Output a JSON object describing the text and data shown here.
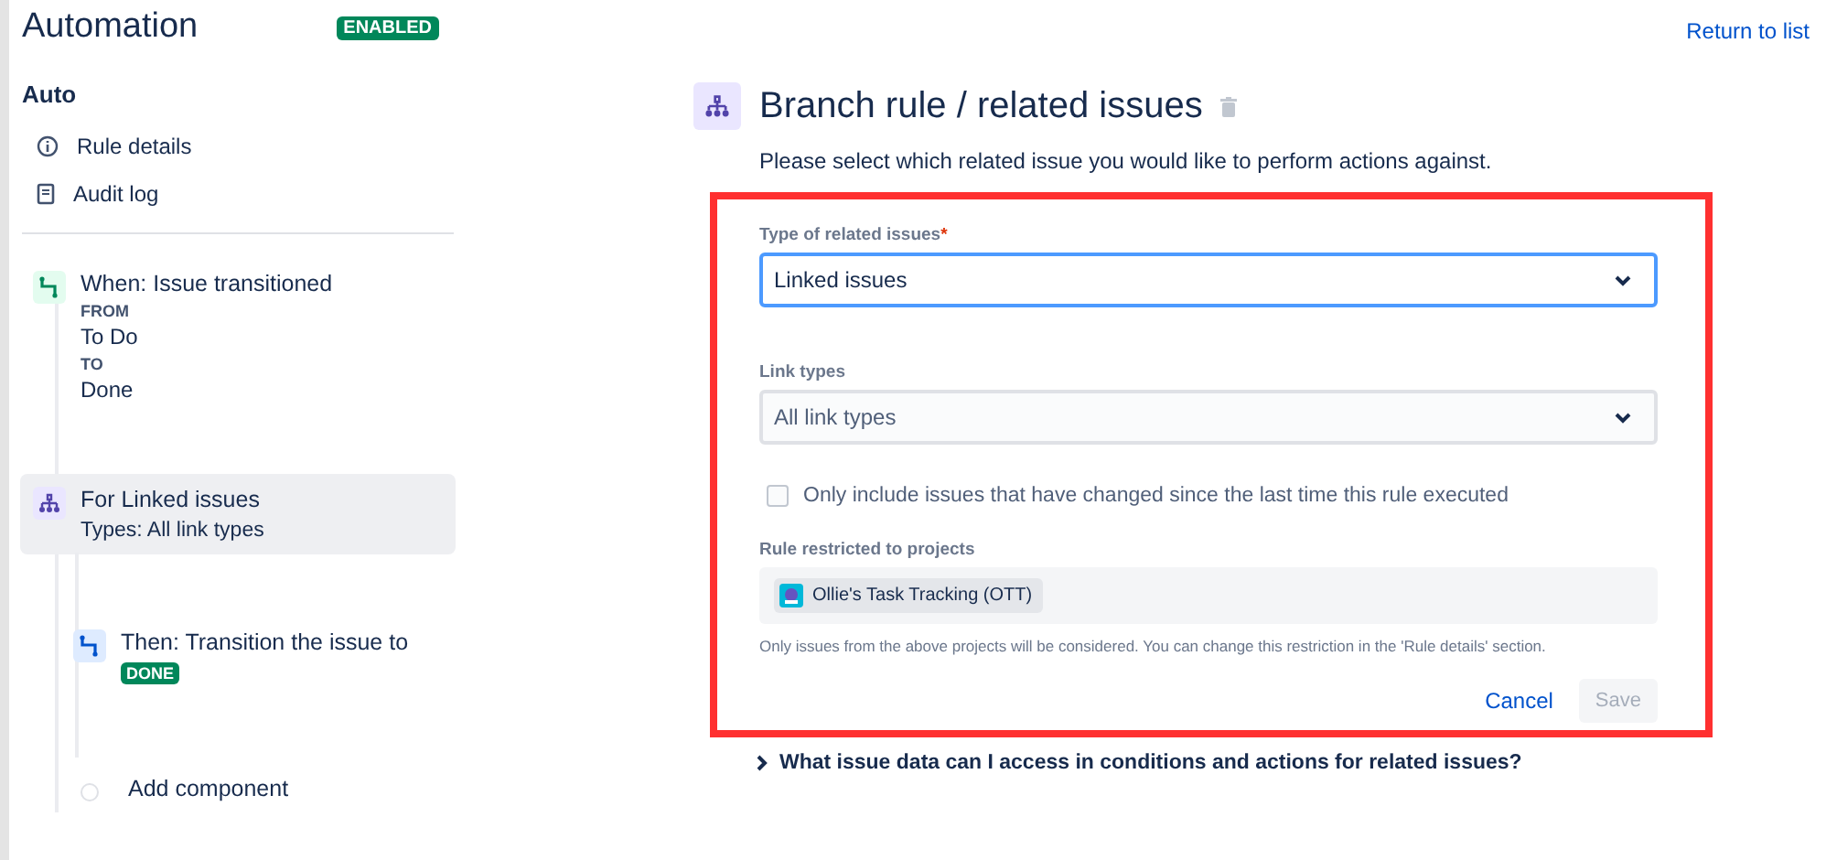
{
  "header": {
    "title": "Automation",
    "status_badge": "ENABLED",
    "return_link": "Return to list"
  },
  "sidebar": {
    "rule_name": "Auto",
    "links": [
      {
        "kind": "info",
        "label": "Rule details"
      },
      {
        "kind": "document",
        "label": "Audit log"
      }
    ],
    "flow": [
      {
        "kind": "trigger",
        "title": "When: Issue transitioned",
        "selected": false,
        "details": [
          {
            "kind": "label",
            "text": "FROM"
          },
          {
            "kind": "value",
            "text": "To Do"
          },
          {
            "kind": "label",
            "text": "TO"
          },
          {
            "kind": "value",
            "text": "Done"
          }
        ]
      },
      {
        "kind": "branch",
        "title": "For Linked issues",
        "subtitle": "Types: All link types",
        "selected": true,
        "children": [
          {
            "kind": "action",
            "title": "Then: Transition the issue to",
            "lozenge": "DONE",
            "selected": false
          },
          {
            "kind": "add",
            "title": "Add component",
            "selected": false
          }
        ]
      }
    ]
  },
  "main": {
    "title": "Branch rule / related issues",
    "description": "Please select which related issue you would like to perform actions against.",
    "form": {
      "type_field": {
        "label": "Type of related issues",
        "required_mark": "*",
        "value": "Linked issues",
        "focused": true
      },
      "link_types": {
        "label": "Link types",
        "value": "All link types",
        "focused": false
      },
      "checkbox": {
        "label": "Only include issues that have changed since the last time this rule executed",
        "checked": false
      },
      "projects": {
        "label": "Rule restricted to projects",
        "chips": [
          "Ollie's Task Tracking (OTT)"
        ],
        "help": "Only issues from the above projects will be considered. You can change this restriction in the 'Rule details' section."
      },
      "cancel": "Cancel",
      "save": {
        "label": "Save",
        "disabled": true
      }
    },
    "faq": "What issue data can I access in conditions and actions for related issues?"
  }
}
